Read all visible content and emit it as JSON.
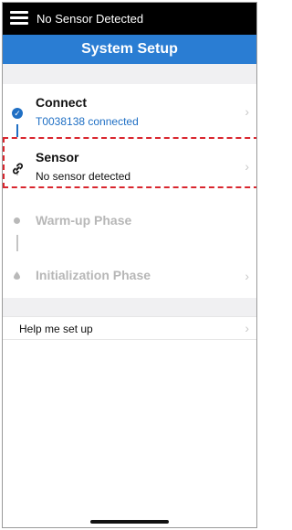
{
  "status_bar": {
    "text": "No Sensor Detected"
  },
  "nav": {
    "title": "System Setup"
  },
  "steps": [
    {
      "title": "Connect",
      "subtitle": "T0038138 connected",
      "icon": "check-circle-icon",
      "state": "complete",
      "chevron": "›"
    },
    {
      "title": "Sensor",
      "subtitle": "No sensor detected",
      "icon": "link-icon",
      "state": "current",
      "chevron": "›"
    },
    {
      "title": "Warm-up Phase",
      "icon": "dot-icon",
      "state": "disabled"
    },
    {
      "title": "Initialization Phase",
      "icon": "drop-icon",
      "state": "disabled",
      "chevron": "›"
    }
  ],
  "help": {
    "label": "Help me set up",
    "chevron": "›"
  },
  "colors": {
    "status_bar": "#000000",
    "nav_bar": "#2a7dd3",
    "accent": "#1f6fc4",
    "disabled_text": "#b7b7b7",
    "highlight_box": "#d9262e",
    "background_gray": "#f0f0f2"
  }
}
